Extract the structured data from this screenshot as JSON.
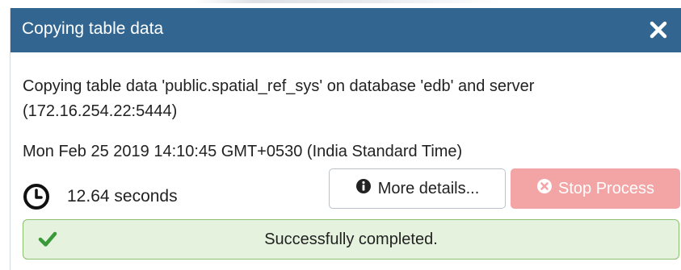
{
  "dialog": {
    "title": "Copying table data",
    "close_icon": "close-icon",
    "message_line1": "Copying table data 'public.spatial_ref_sys' on database 'edb' and server",
    "message_line2": "(172.16.254.22:5444)",
    "timestamp": "Mon Feb 25 2019 14:10:45 GMT+0530 (India Standard Time)",
    "elapsed": "12.64 seconds",
    "more_details_label": "More details...",
    "stop_process_label": "Stop Process",
    "status_text": "Successfully completed."
  },
  "colors": {
    "titlebar": "#326690",
    "stop_button": "#f3a4a4",
    "success_bg": "#e5f2de",
    "success_border": "#8ac06f",
    "success_icon": "#3a9a3a"
  },
  "icons": {
    "clock": "clock-icon",
    "info": "info-icon",
    "stop": "times-circle-icon",
    "check": "check-icon"
  }
}
